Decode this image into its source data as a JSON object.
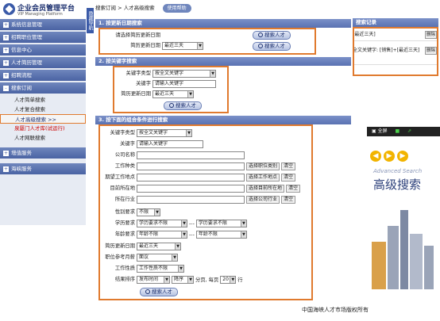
{
  "logo": {
    "title": "企业会员管理平台",
    "subtitle": "VIP Managing Platform"
  },
  "sidebar": {
    "sections": [
      {
        "label": "系统信息管理"
      },
      {
        "label": "招聘职位管理"
      },
      {
        "label": "信息中心"
      },
      {
        "label": "人才简历管理"
      },
      {
        "label": "招聘流程"
      },
      {
        "label": "搜索订阅"
      },
      {
        "label": "增值服务"
      },
      {
        "label": "海峡服务"
      }
    ],
    "subitems": [
      {
        "label": "人才简单搜索"
      },
      {
        "label": "人才复合搜索"
      },
      {
        "label": "人才高级搜索 >>"
      },
      {
        "label": "泉厦门人才库(试运行)"
      },
      {
        "label": "人才网联搜索"
      }
    ],
    "vtab": "隐藏导航"
  },
  "toolbar": {
    "crumb1": "搜索订阅",
    "crumb2": "人才高级搜索",
    "help": "使用帮助"
  },
  "sec1": {
    "title": "1. 按更新日期搜索",
    "label1": "请选择简历更新日期",
    "label2": "简历更新日期",
    "date": "最近三天",
    "btn": "搜索人才"
  },
  "sec2": {
    "title": "2. 按关键字搜索",
    "type_label": "关键字类型",
    "type_value": "按全文关键字",
    "kw_label": "关键字",
    "kw_placeholder": "请输入关键字",
    "date_label": "简历更新日期",
    "date_value": "最近三天",
    "btn": "搜索人才"
  },
  "sec3": {
    "title": "3. 按下面的组合条件进行搜索",
    "type_label": "关键字类型",
    "type_value": "按全文关键字",
    "kw_label": "关键字",
    "kw_placeholder": "请输入关键字",
    "company_label": "公司名称",
    "job_label": "工作种类",
    "job_btn": "选择职位类别",
    "loc_label": "期望工作地点",
    "loc_btn": "选择工作地点",
    "cur_label": "目前所在地",
    "cur_btn": "选择目前所在地",
    "ind_label": "所在行业",
    "ind_btn": "选择公司行业",
    "clear": "清空",
    "gender_label": "性别要求",
    "gender_value": "不限",
    "edu_label": "学历要求",
    "edu_from": "学历要求不限",
    "edu_to": "学历要求不限",
    "dash": "---",
    "age_label": "年龄要求",
    "age_from": "年龄不限",
    "age_to": "年龄不限",
    "upd_label": "简历更新日期",
    "upd_value": "最近三天",
    "salary_label": "职位参考月薪",
    "salary_value": "面议",
    "nature_label": "工作性质",
    "nature_value": "工作性质不限",
    "sort_label": "结果排序",
    "sort_by": "发布时间",
    "sort_dir": "降序",
    "page_text": "分页, 每页",
    "page_size": "20",
    "page_unit": "行",
    "btn": "搜索人才"
  },
  "records": {
    "title": "搜索记录",
    "items": [
      {
        "text": "[最近三天]",
        "del": "删除"
      },
      {
        "text": "全文关键字: [销售]+[最近三天]",
        "del": "删除"
      }
    ]
  },
  "adv": {
    "fullscreen": "全屏",
    "en": "Advanced Search",
    "zh": "高级搜索"
  },
  "footer": "中国海峡人才市场版权所有"
}
